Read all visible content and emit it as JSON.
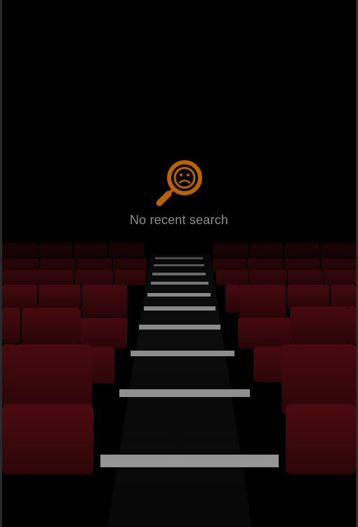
{
  "empty_state": {
    "icon": "search-no-results-icon",
    "message": "No recent search",
    "icon_color": "#b8620c",
    "text_color": "#8e8e8e"
  },
  "background": {
    "icon": "cinema-seats-background",
    "seat_color": "#5a0d12",
    "base_color": "#000000"
  }
}
